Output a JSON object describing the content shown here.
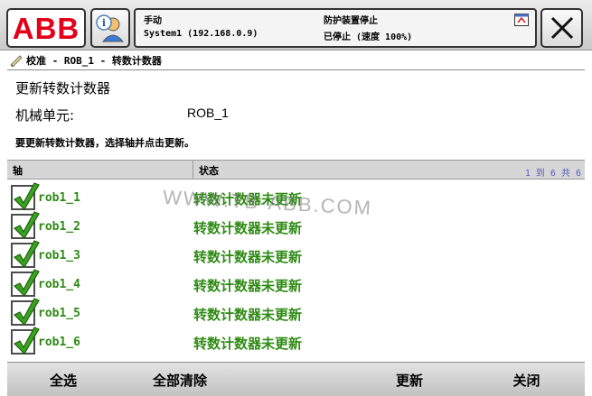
{
  "topbar": {
    "logo_text": "ABB",
    "mode": "手动",
    "system": "System1 (192.168.0.9)",
    "safety": "防护装置停止",
    "speed": "已停止 (速度 100%)"
  },
  "breadcrumb": "校准 - ROB_1 - 转数计数器",
  "header": {
    "title": "更新转数计数器",
    "unit_label": "机械单元:",
    "unit_value": "ROB_1",
    "instruction": "要更新转数计数器，选择轴并点击更新。"
  },
  "table": {
    "col_axis": "轴",
    "col_state": "状态",
    "pager": "1 到 6 共 6",
    "rows": [
      {
        "axis": "rob1_1",
        "state": "转数计数器未更新",
        "checked": true
      },
      {
        "axis": "rob1_2",
        "state": "转数计数器未更新",
        "checked": true
      },
      {
        "axis": "rob1_3",
        "state": "转数计数器未更新",
        "checked": true
      },
      {
        "axis": "rob1_4",
        "state": "转数计数器未更新",
        "checked": true
      },
      {
        "axis": "rob1_5",
        "state": "转数计数器未更新",
        "checked": true
      },
      {
        "axis": "rob1_6",
        "state": "转数计数器未更新",
        "checked": true
      }
    ]
  },
  "watermark": "WWW.TB-ABB.COM",
  "bottombar": {
    "select_all": "全选",
    "clear_all": "全部清除",
    "update": "更新",
    "close": "关闭"
  },
  "colors": {
    "brand_red": "#e2001a",
    "status_green": "#2e8a14",
    "pager_blue": "#5b5bbd"
  },
  "icons": {
    "user": "user-info-icon",
    "status": "status-window-icon",
    "close": "close-x-icon",
    "breadcrumb": "calibration-icon",
    "check": "checkmark-icon"
  }
}
